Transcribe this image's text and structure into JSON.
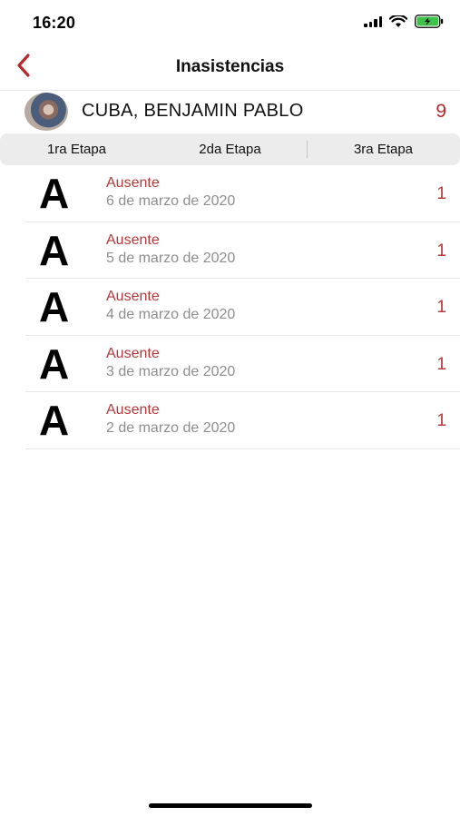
{
  "status_bar": {
    "time": "16:20",
    "icons": [
      "signal-icon",
      "wifi-icon",
      "battery-charging-icon"
    ]
  },
  "nav": {
    "title": "Inasistencias",
    "back_icon": "chevron-left-icon"
  },
  "student": {
    "name": "CUBA, BENJAMIN PABLO",
    "total": "9"
  },
  "tabs": [
    {
      "label": "1ra Etapa"
    },
    {
      "label": "2da Etapa"
    },
    {
      "label": "3ra Etapa"
    }
  ],
  "absences": [
    {
      "letter": "A",
      "type": "Ausente",
      "date": "6 de marzo de 2020",
      "count": "1"
    },
    {
      "letter": "A",
      "type": "Ausente",
      "date": "5 de marzo de 2020",
      "count": "1"
    },
    {
      "letter": "A",
      "type": "Ausente",
      "date": "4 de marzo de 2020",
      "count": "1"
    },
    {
      "letter": "A",
      "type": "Ausente",
      "date": "3 de marzo de 2020",
      "count": "1"
    },
    {
      "letter": "A",
      "type": "Ausente",
      "date": "2 de marzo de 2020",
      "count": "1"
    }
  ],
  "colors": {
    "accent": "#b8282c",
    "secondary_text": "#8e8e8e",
    "segmented_bg": "#ececec"
  }
}
